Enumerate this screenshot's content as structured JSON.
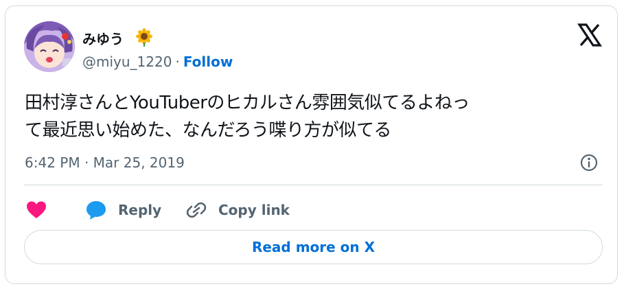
{
  "user": {
    "display_name": "みゆう",
    "handle": "@miyu_1220",
    "separator": "·",
    "follow_label": "Follow"
  },
  "tweet": {
    "text_line1": "田村淳さんとYouTuberのヒカルさん雰囲気似てるよねっ",
    "text_line2": "て最近思い始めた、なんだろう喋り方が似てる",
    "timestamp": "6:42 PM · Mar 25, 2019"
  },
  "actions": {
    "reply_label": "Reply",
    "copy_link_label": "Copy link"
  },
  "read_more_label": "Read more on X",
  "icons": {
    "like": "heart-icon",
    "reply": "speech-bubble-icon",
    "copy": "link-icon",
    "brand": "x-logo-icon",
    "info": "info-icon",
    "emoji": "sunflower-emoji"
  },
  "colors": {
    "link_blue": "#006fd6",
    "like_pink": "#f91880",
    "reply_blue": "#1d9bf0",
    "muted": "#536471",
    "border": "#cfd9de"
  }
}
